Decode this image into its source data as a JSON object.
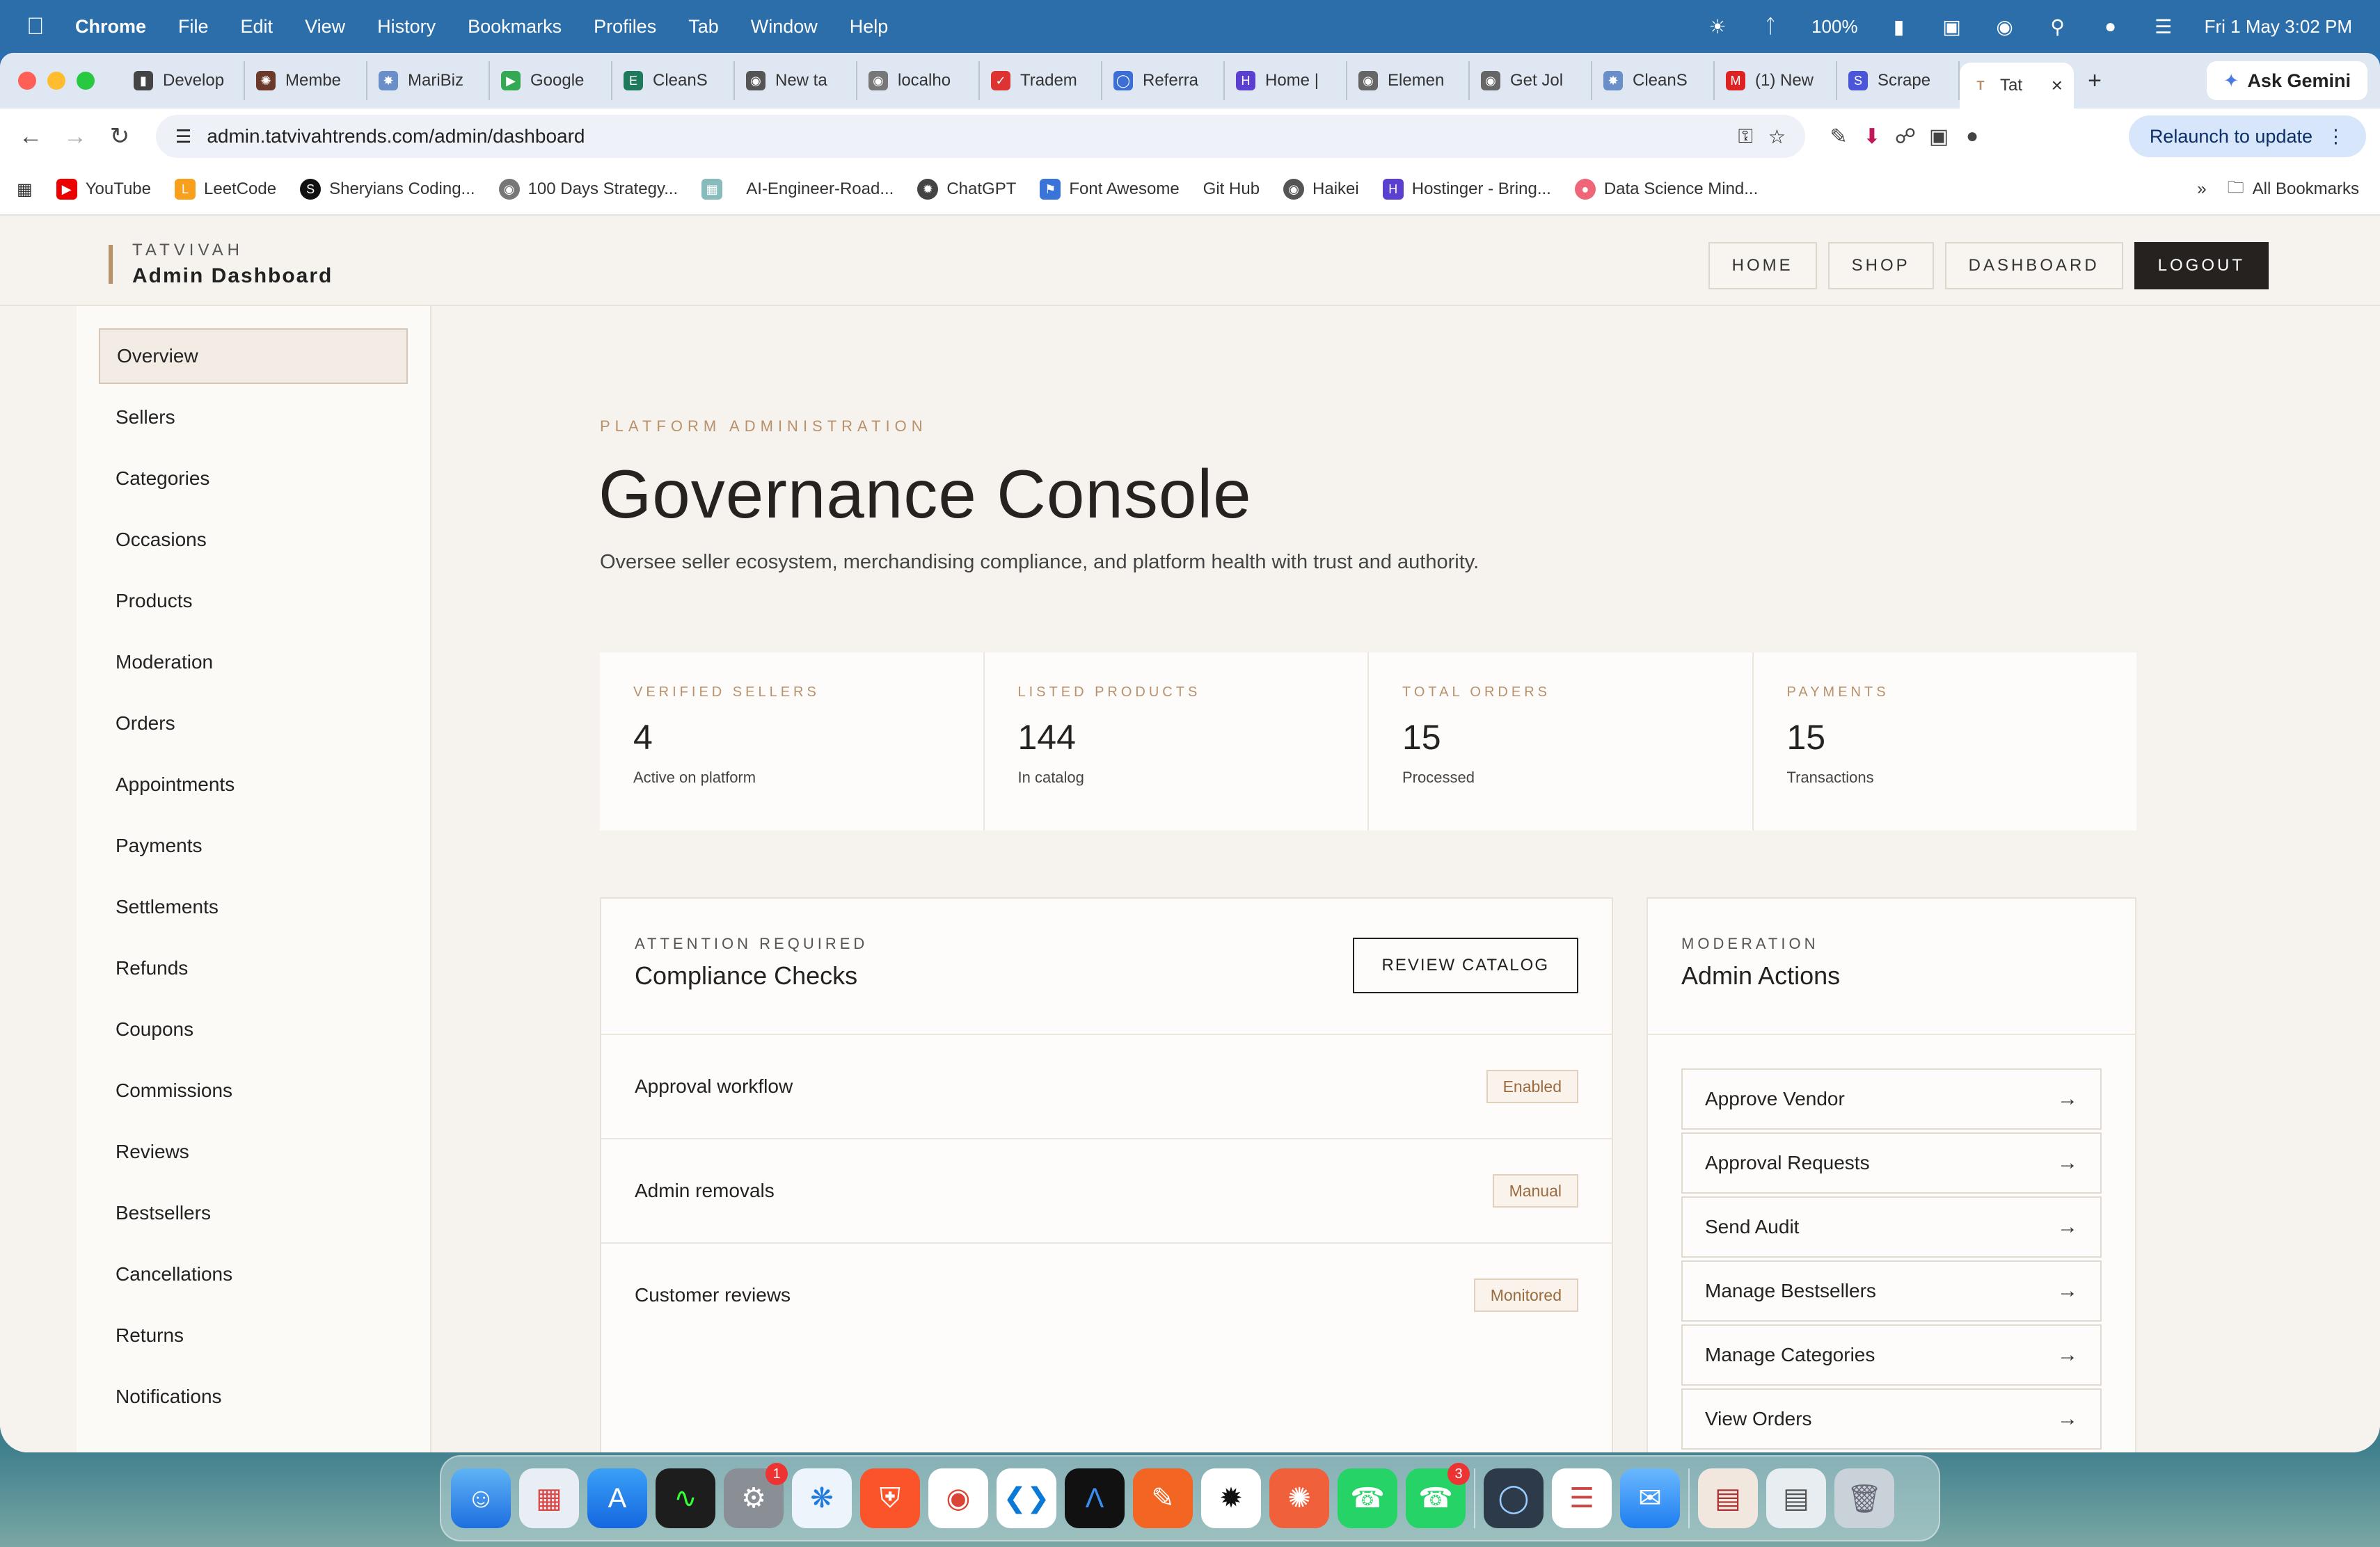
{
  "menubar": {
    "app": "Chrome",
    "items": [
      "File",
      "Edit",
      "View",
      "History",
      "Bookmarks",
      "Profiles",
      "Tab",
      "Window",
      "Help"
    ],
    "battery": "100%",
    "datetime": "Fri 1 May  3:02 PM"
  },
  "tabs": [
    "Develop",
    "Membe",
    "MariBiz",
    "Google",
    "CleanS",
    "New ta",
    "localho",
    "Tradem",
    "Referra",
    "Home |",
    "Elemen",
    "Get Jol",
    "CleanS",
    "(1) New",
    "Scrape"
  ],
  "active_tab": "Tat",
  "gemini_label": "Ask Gemini",
  "url": "admin.tatvivahtrends.com/admin/dashboard",
  "relaunch_label": "Relaunch to update",
  "bookmarks": [
    "YouTube",
    "LeetCode",
    "Sheryians Coding...",
    "100 Days Strategy...",
    "AI-Engineer-Road...",
    "ChatGPT",
    "Font Awesome",
    "Git Hub",
    "Haikei",
    "Hostinger - Bring...",
    "Data Science Mind..."
  ],
  "all_bookmarks": "All Bookmarks",
  "brand": {
    "small": "TATVIVAH",
    "big": "Admin Dashboard"
  },
  "topnav": [
    "HOME",
    "SHOP",
    "DASHBOARD",
    "LOGOUT"
  ],
  "sidebar": [
    "Overview",
    "Sellers",
    "Categories",
    "Occasions",
    "Products",
    "Moderation",
    "Orders",
    "Appointments",
    "Payments",
    "Settlements",
    "Refunds",
    "Coupons",
    "Commissions",
    "Reviews",
    "Bestsellers",
    "Cancellations",
    "Returns",
    "Notifications"
  ],
  "hero": {
    "eyebrow": "PLATFORM ADMINISTRATION",
    "title": "Governance Console",
    "lead": "Oversee seller ecosystem, merchandising compliance, and platform health with trust and authority."
  },
  "stats": [
    {
      "label": "VERIFIED SELLERS",
      "value": "4",
      "sub": "Active on platform"
    },
    {
      "label": "LISTED PRODUCTS",
      "value": "144",
      "sub": "In catalog"
    },
    {
      "label": "TOTAL ORDERS",
      "value": "15",
      "sub": "Processed"
    },
    {
      "label": "PAYMENTS",
      "value": "15",
      "sub": "Transactions"
    }
  ],
  "compliance": {
    "eyebrow": "ATTENTION REQUIRED",
    "title": "Compliance Checks",
    "button": "REVIEW CATALOG",
    "rows": [
      {
        "label": "Approval workflow",
        "badge": "Enabled"
      },
      {
        "label": "Admin removals",
        "badge": "Manual"
      },
      {
        "label": "Customer reviews",
        "badge": "Monitored"
      }
    ]
  },
  "actions": {
    "eyebrow": "MODERATION",
    "title": "Admin Actions",
    "items": [
      "Approve Vendor",
      "Approval Requests",
      "Send Audit",
      "Manage Bestsellers",
      "Manage Categories",
      "View Orders"
    ],
    "arrow": "→"
  },
  "dock_badges": [
    "1",
    "3"
  ],
  "colors": {
    "accent": "#b8916b",
    "dark": "#262220",
    "page_bg": "#f6f3ee",
    "chrome_blue": "#2c6ea9"
  }
}
